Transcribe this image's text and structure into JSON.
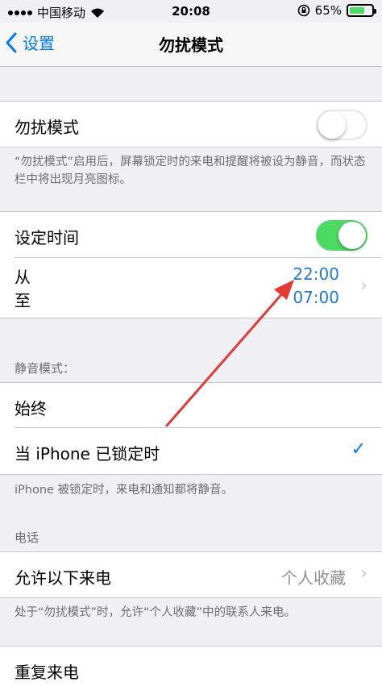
{
  "status": {
    "carrier": "中国移动",
    "time": "20:08",
    "battery": "65%"
  },
  "nav": {
    "back_label": "设置",
    "title": "勿扰模式"
  },
  "dnd": {
    "label": "勿扰模式",
    "enabled": false,
    "footer": "“勿扰模式”启用后，屏幕锁定时的来电和提醒将被设为静音，而状态栏中将出现月亮图标。"
  },
  "scheduled": {
    "label": "设定时间",
    "enabled": true,
    "from_label": "从",
    "to_label": "至",
    "from_time": "22:00",
    "to_time": "07:00"
  },
  "silence": {
    "header": "静音模式：",
    "always_label": "始终",
    "locked_label": "当 iPhone 已锁定时",
    "footer": "iPhone 被锁定时，来电和通知都将静音。"
  },
  "phone": {
    "header": "电话",
    "allow_label": "允许以下来电",
    "allow_value": "个人收藏",
    "footer": "处于“勿扰模式”时，允许“个人收藏”中的联系人来电。",
    "repeated_label": "重复来电"
  },
  "colors": {
    "accent": "#007aff",
    "toggle_on": "#4cd964",
    "annotation_arrow": "#e53935"
  }
}
